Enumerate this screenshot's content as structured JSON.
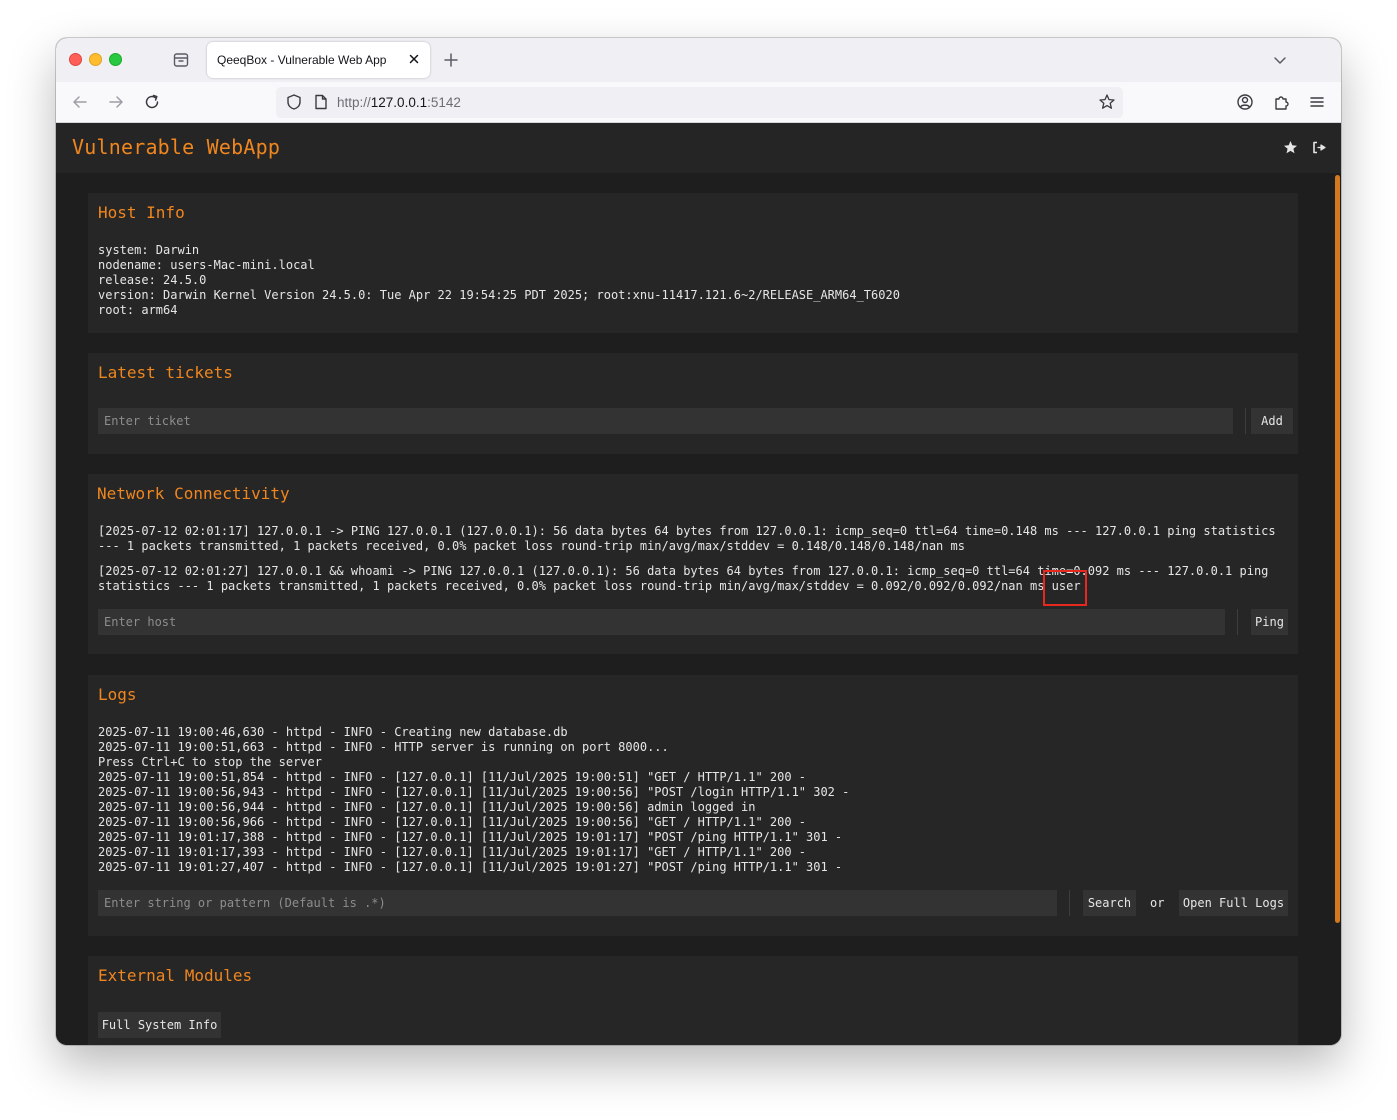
{
  "browser": {
    "tab_title": "QeeqBox - Vulnerable Web App",
    "url_scheme": "http://",
    "url_host": "127.0.0.1",
    "url_port": ":5142"
  },
  "app": {
    "title": "Vulnerable WebApp",
    "accent_color": "#f0861e"
  },
  "host_info": {
    "title": "Host Info",
    "lines": [
      "system: Darwin",
      "nodename: users-Mac-mini.local",
      "release: 24.5.0",
      "version: Darwin Kernel Version 24.5.0: Tue Apr 22 19:54:25 PDT 2025; root:xnu-11417.121.6~2/RELEASE_ARM64_T6020",
      "root: arm64"
    ]
  },
  "tickets": {
    "title": "Latest tickets",
    "placeholder": "Enter ticket",
    "add_label": "Add"
  },
  "network": {
    "title": "Network Connectivity",
    "results": [
      "[2025-07-12 02:01:17] 127.0.0.1 -> PING 127.0.0.1 (127.0.0.1): 56 data bytes 64 bytes from 127.0.0.1: icmp_seq=0 ttl=64 time=0.148 ms --- 127.0.0.1 ping statistics --- 1 packets transmitted, 1 packets received, 0.0% packet loss round-trip min/avg/max/stddev = 0.148/0.148/0.148/nan ms",
      "[2025-07-12 02:01:27] 127.0.0.1 && whoami -> PING 127.0.0.1 (127.0.0.1): 56 data bytes 64 bytes from 127.0.0.1: icmp_seq=0 ttl=64 time=0.092 ms --- 127.0.0.1 ping statistics --- 1 packets transmitted, 1 packets received, 0.0% packet loss round-trip min/avg/max/stddev = 0.092/0.092/0.092/nan ms"
    ],
    "whoami_output": "user",
    "placeholder": "Enter host",
    "ping_label": "Ping"
  },
  "logs": {
    "title": "Logs",
    "lines": [
      "2025-07-11 19:00:46,630 - httpd - INFO - Creating new database.db",
      "2025-07-11 19:00:51,663 - httpd - INFO - HTTP server is running on port 8000...",
      "Press Ctrl+C to stop the server",
      "2025-07-11 19:00:51,854 - httpd - INFO - [127.0.0.1] [11/Jul/2025 19:00:51] \"GET / HTTP/1.1\" 200 -",
      "2025-07-11 19:00:56,943 - httpd - INFO - [127.0.0.1] [11/Jul/2025 19:00:56] \"POST /login HTTP/1.1\" 302 -",
      "2025-07-11 19:00:56,944 - httpd - INFO - [127.0.0.1] [11/Jul/2025 19:00:56] admin logged in",
      "2025-07-11 19:00:56,966 - httpd - INFO - [127.0.0.1] [11/Jul/2025 19:00:56] \"GET / HTTP/1.1\" 200 -",
      "2025-07-11 19:01:17,388 - httpd - INFO - [127.0.0.1] [11/Jul/2025 19:01:17] \"POST /ping HTTP/1.1\" 301 -",
      "2025-07-11 19:01:17,393 - httpd - INFO - [127.0.0.1] [11/Jul/2025 19:01:17] \"GET / HTTP/1.1\" 200 -",
      "2025-07-11 19:01:27,407 - httpd - INFO - [127.0.0.1] [11/Jul/2025 19:01:27] \"POST /ping HTTP/1.1\" 301 -"
    ],
    "placeholder": "Enter string or pattern (Default is .*)",
    "search_label": "Search",
    "or_label": "or",
    "open_full_label": "Open Full Logs"
  },
  "external": {
    "title": "External Modules",
    "full_system_label": "Full System Info"
  }
}
